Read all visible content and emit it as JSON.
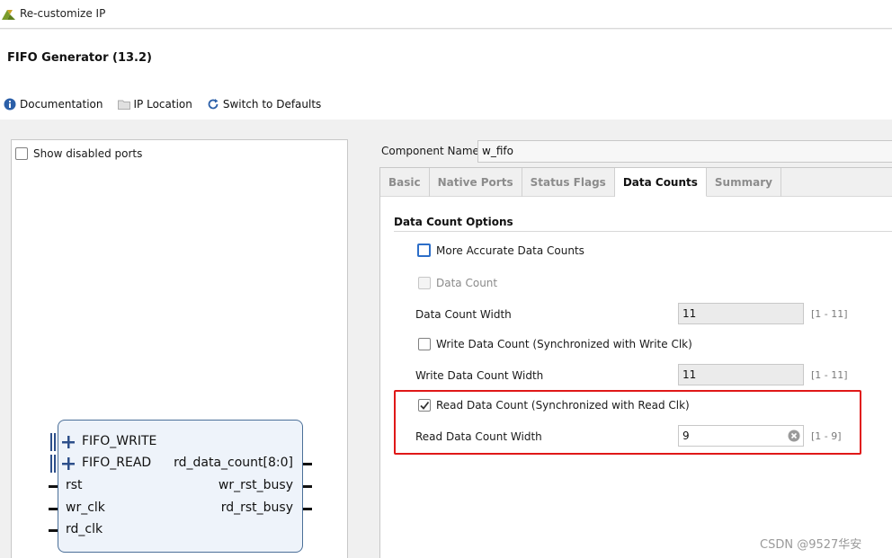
{
  "window": {
    "title": "Re-customize IP"
  },
  "header": {
    "heading": "FIFO Generator (13.2)"
  },
  "toolbar": {
    "documentation": "Documentation",
    "ip_location": "IP Location",
    "switch_defaults": "Switch to Defaults"
  },
  "left_panel": {
    "show_disabled_ports": "Show disabled ports",
    "ports_left": [
      "FIFO_WRITE",
      "FIFO_READ",
      "rst",
      "wr_clk",
      "rd_clk"
    ],
    "ports_right": [
      "rd_data_count[8:0]",
      "wr_rst_busy",
      "rd_rst_busy"
    ]
  },
  "component": {
    "label": "Component Name",
    "value": "w_fifo"
  },
  "tabs": [
    "Basic",
    "Native Ports",
    "Status Flags",
    "Data Counts",
    "Summary"
  ],
  "active_tab": "Data Counts",
  "data_counts": {
    "section_title": "Data Count Options",
    "more_accurate": "More Accurate Data Counts",
    "data_count": "Data Count",
    "data_count_width_label": "Data Count Width",
    "data_count_width_value": "11",
    "data_count_width_range": "[1 - 11]",
    "write_data_count": "Write Data Count (Synchronized with Write Clk)",
    "write_data_count_width_label": "Write Data Count Width",
    "write_data_count_width_value": "11",
    "write_data_count_width_range": "[1 - 11]",
    "read_data_count": "Read Data Count (Synchronized with Read Clk)",
    "read_data_count_width_label": "Read Data Count Width",
    "read_data_count_width_value": "9",
    "read_data_count_width_range": "[1 - 9]"
  },
  "watermark": "CSDN @9527华安",
  "colors": {
    "accent_blue": "#2d6ec8",
    "highlight_red": "#e01818"
  }
}
